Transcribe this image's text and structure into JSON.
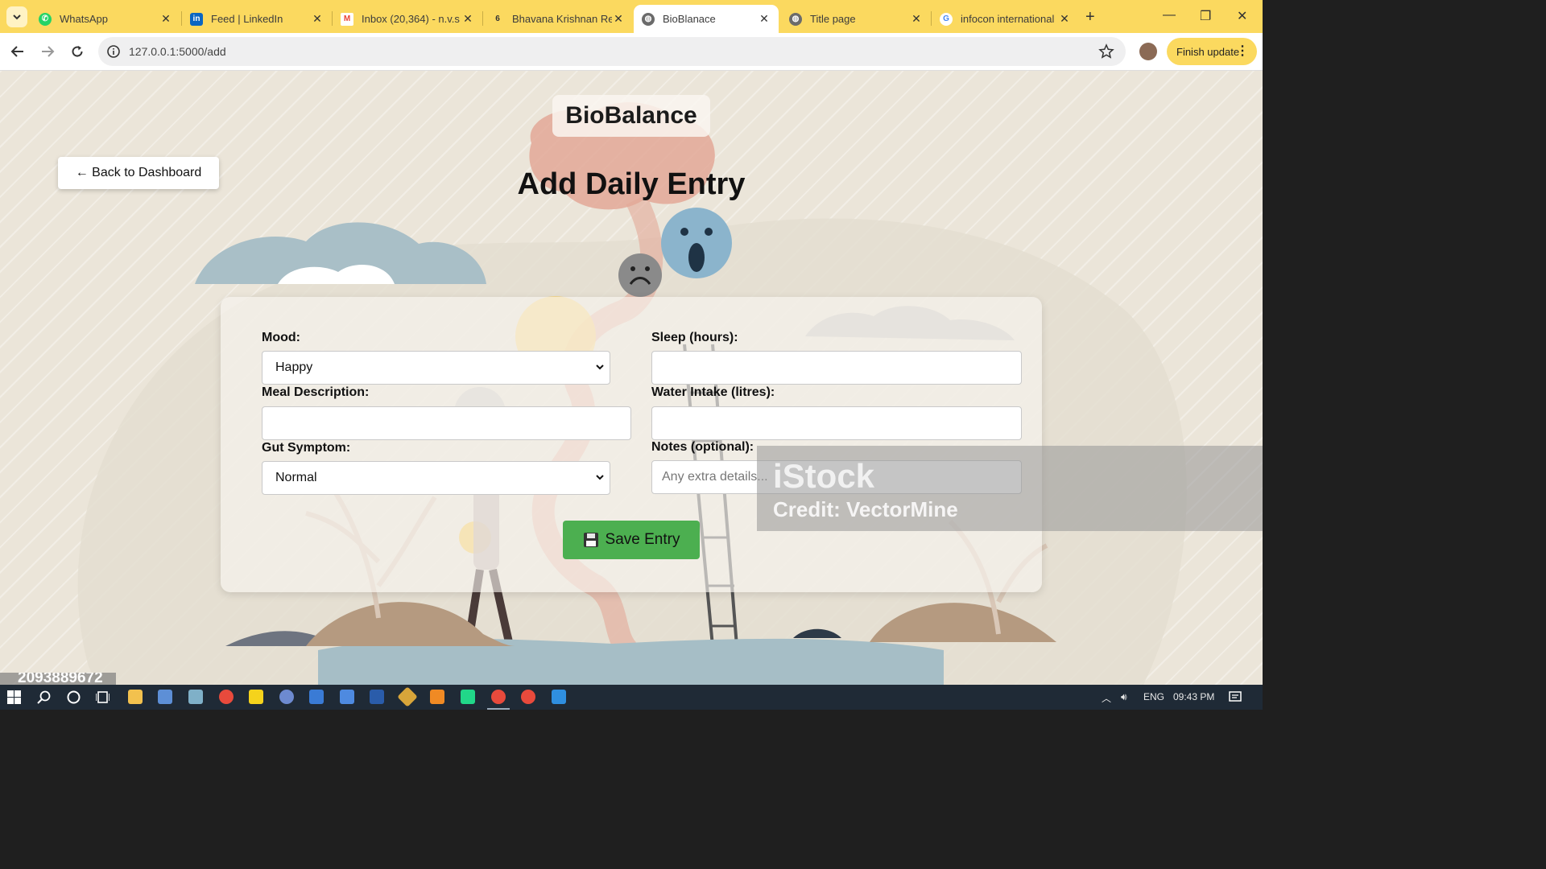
{
  "browser": {
    "tabs": [
      {
        "title": "WhatsApp",
        "icon": "whatsapp-icon",
        "color": "#25d366",
        "active": false
      },
      {
        "title": "Feed | LinkedIn",
        "icon": "linkedin-icon",
        "color": "#0a66c2",
        "active": false
      },
      {
        "title": "Inbox (20,364) - n.v.s",
        "icon": "gmail-icon",
        "color": "#ea4335",
        "active": false
      },
      {
        "title": "Bhavana Krishnan Re",
        "icon": "copilot-icon",
        "color": "#555555",
        "active": false
      },
      {
        "title": "BioBlanace",
        "icon": "globe-icon",
        "color": "#6b6b6b",
        "active": true
      },
      {
        "title": "Title page",
        "icon": "globe-icon",
        "color": "#6b6b6b",
        "active": false
      },
      {
        "title": "infocon international",
        "icon": "google-icon",
        "color": "#4285f4",
        "active": false
      }
    ],
    "url": "127.0.0.1:5000/add",
    "finish_update_label": "Finish update"
  },
  "page": {
    "brand": "BioBalance",
    "back_label": "← Back to Dashboard",
    "heading": "Add Daily Entry",
    "form": {
      "mood_label": "Mood:",
      "mood_value": "Happy",
      "sleep_label": "Sleep (hours):",
      "sleep_value": "",
      "meal_label": "Meal Description:",
      "meal_value": "",
      "water_label": "Water Intake (litres):",
      "water_value": "",
      "gut_label": "Gut Symptom:",
      "gut_value": "Normal",
      "notes_label": "Notes (optional):",
      "notes_placeholder": "Any extra details...",
      "save_label": "Save Entry",
      "save_color": "#4caf50"
    },
    "watermark": {
      "logo": "iStock",
      "credit": "Credit: VectorMine",
      "stock_id": "2093889672"
    }
  },
  "taskbar": {
    "language": "ENG",
    "time": "09:43 PM"
  }
}
